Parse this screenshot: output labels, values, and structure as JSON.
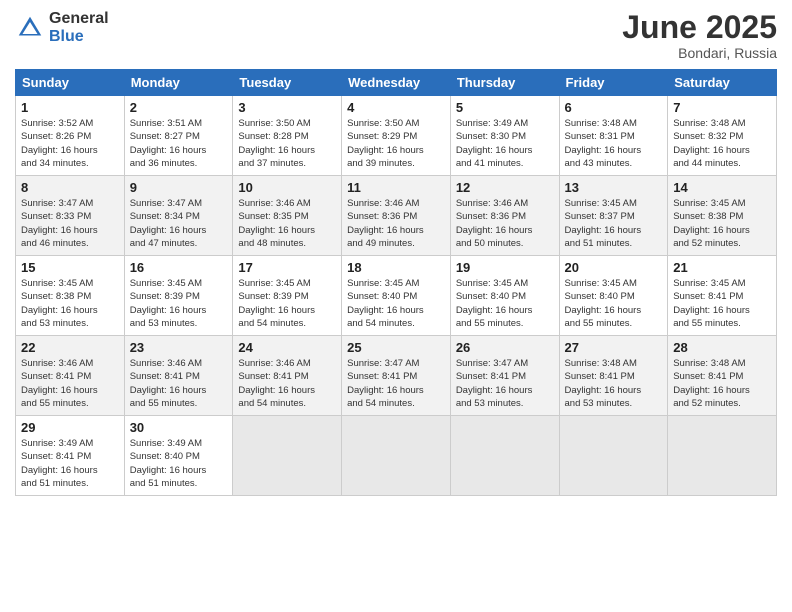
{
  "logo": {
    "general": "General",
    "blue": "Blue"
  },
  "title": "June 2025",
  "location": "Bondari, Russia",
  "days_header": [
    "Sunday",
    "Monday",
    "Tuesday",
    "Wednesday",
    "Thursday",
    "Friday",
    "Saturday"
  ],
  "weeks": [
    [
      {
        "day": "1",
        "info": "Sunrise: 3:52 AM\nSunset: 8:26 PM\nDaylight: 16 hours\nand 34 minutes."
      },
      {
        "day": "2",
        "info": "Sunrise: 3:51 AM\nSunset: 8:27 PM\nDaylight: 16 hours\nand 36 minutes."
      },
      {
        "day": "3",
        "info": "Sunrise: 3:50 AM\nSunset: 8:28 PM\nDaylight: 16 hours\nand 37 minutes."
      },
      {
        "day": "4",
        "info": "Sunrise: 3:50 AM\nSunset: 8:29 PM\nDaylight: 16 hours\nand 39 minutes."
      },
      {
        "day": "5",
        "info": "Sunrise: 3:49 AM\nSunset: 8:30 PM\nDaylight: 16 hours\nand 41 minutes."
      },
      {
        "day": "6",
        "info": "Sunrise: 3:48 AM\nSunset: 8:31 PM\nDaylight: 16 hours\nand 43 minutes."
      },
      {
        "day": "7",
        "info": "Sunrise: 3:48 AM\nSunset: 8:32 PM\nDaylight: 16 hours\nand 44 minutes."
      }
    ],
    [
      {
        "day": "8",
        "info": "Sunrise: 3:47 AM\nSunset: 8:33 PM\nDaylight: 16 hours\nand 46 minutes."
      },
      {
        "day": "9",
        "info": "Sunrise: 3:47 AM\nSunset: 8:34 PM\nDaylight: 16 hours\nand 47 minutes."
      },
      {
        "day": "10",
        "info": "Sunrise: 3:46 AM\nSunset: 8:35 PM\nDaylight: 16 hours\nand 48 minutes."
      },
      {
        "day": "11",
        "info": "Sunrise: 3:46 AM\nSunset: 8:36 PM\nDaylight: 16 hours\nand 49 minutes."
      },
      {
        "day": "12",
        "info": "Sunrise: 3:46 AM\nSunset: 8:36 PM\nDaylight: 16 hours\nand 50 minutes."
      },
      {
        "day": "13",
        "info": "Sunrise: 3:45 AM\nSunset: 8:37 PM\nDaylight: 16 hours\nand 51 minutes."
      },
      {
        "day": "14",
        "info": "Sunrise: 3:45 AM\nSunset: 8:38 PM\nDaylight: 16 hours\nand 52 minutes."
      }
    ],
    [
      {
        "day": "15",
        "info": "Sunrise: 3:45 AM\nSunset: 8:38 PM\nDaylight: 16 hours\nand 53 minutes."
      },
      {
        "day": "16",
        "info": "Sunrise: 3:45 AM\nSunset: 8:39 PM\nDaylight: 16 hours\nand 53 minutes."
      },
      {
        "day": "17",
        "info": "Sunrise: 3:45 AM\nSunset: 8:39 PM\nDaylight: 16 hours\nand 54 minutes."
      },
      {
        "day": "18",
        "info": "Sunrise: 3:45 AM\nSunset: 8:40 PM\nDaylight: 16 hours\nand 54 minutes."
      },
      {
        "day": "19",
        "info": "Sunrise: 3:45 AM\nSunset: 8:40 PM\nDaylight: 16 hours\nand 55 minutes."
      },
      {
        "day": "20",
        "info": "Sunrise: 3:45 AM\nSunset: 8:40 PM\nDaylight: 16 hours\nand 55 minutes."
      },
      {
        "day": "21",
        "info": "Sunrise: 3:45 AM\nSunset: 8:41 PM\nDaylight: 16 hours\nand 55 minutes."
      }
    ],
    [
      {
        "day": "22",
        "info": "Sunrise: 3:46 AM\nSunset: 8:41 PM\nDaylight: 16 hours\nand 55 minutes."
      },
      {
        "day": "23",
        "info": "Sunrise: 3:46 AM\nSunset: 8:41 PM\nDaylight: 16 hours\nand 55 minutes."
      },
      {
        "day": "24",
        "info": "Sunrise: 3:46 AM\nSunset: 8:41 PM\nDaylight: 16 hours\nand 54 minutes."
      },
      {
        "day": "25",
        "info": "Sunrise: 3:47 AM\nSunset: 8:41 PM\nDaylight: 16 hours\nand 54 minutes."
      },
      {
        "day": "26",
        "info": "Sunrise: 3:47 AM\nSunset: 8:41 PM\nDaylight: 16 hours\nand 53 minutes."
      },
      {
        "day": "27",
        "info": "Sunrise: 3:48 AM\nSunset: 8:41 PM\nDaylight: 16 hours\nand 53 minutes."
      },
      {
        "day": "28",
        "info": "Sunrise: 3:48 AM\nSunset: 8:41 PM\nDaylight: 16 hours\nand 52 minutes."
      }
    ],
    [
      {
        "day": "29",
        "info": "Sunrise: 3:49 AM\nSunset: 8:41 PM\nDaylight: 16 hours\nand 51 minutes."
      },
      {
        "day": "30",
        "info": "Sunrise: 3:49 AM\nSunset: 8:40 PM\nDaylight: 16 hours\nand 51 minutes."
      },
      {
        "day": "",
        "info": ""
      },
      {
        "day": "",
        "info": ""
      },
      {
        "day": "",
        "info": ""
      },
      {
        "day": "",
        "info": ""
      },
      {
        "day": "",
        "info": ""
      }
    ]
  ]
}
